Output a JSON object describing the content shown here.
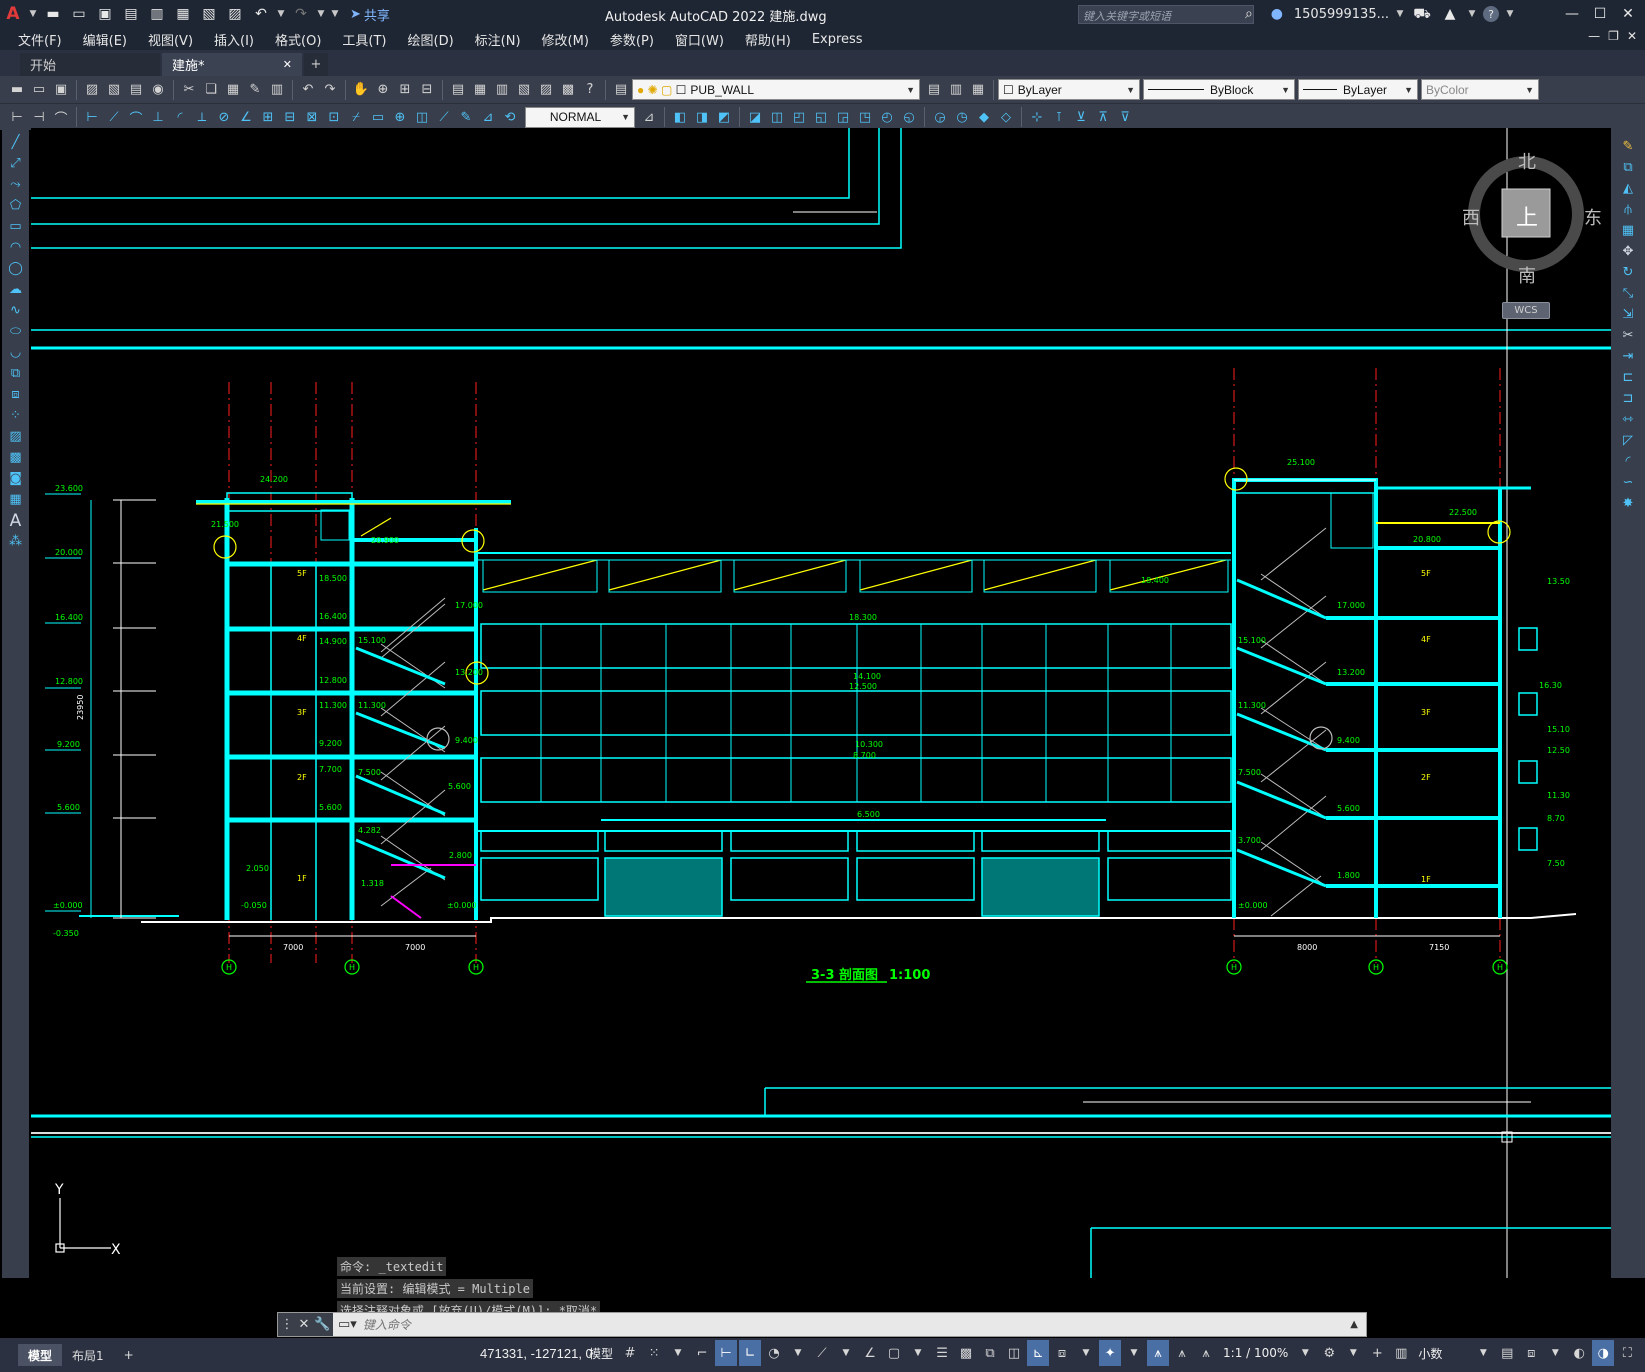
{
  "titlebar": {
    "app_letter": "A",
    "share_label": "共享",
    "title": "Autodesk AutoCAD 2022    建施.dwg",
    "search_placeholder": "键入关键字或短语",
    "user": "1505999135...",
    "help": "?"
  },
  "menu": [
    "文件(F)",
    "编辑(E)",
    "视图(V)",
    "插入(I)",
    "格式(O)",
    "工具(T)",
    "绘图(D)",
    "标注(N)",
    "修改(M)",
    "参数(P)",
    "窗口(W)",
    "帮助(H)",
    "Express"
  ],
  "tabs": {
    "start": "开始",
    "current": "建施*",
    "close": "✕",
    "add": "+"
  },
  "toolbar": {
    "layer": "PUB_WALL",
    "color": "ByLayer",
    "linetype": "ByBlock",
    "lineweight": "ByLayer",
    "plotstyle": "ByColor",
    "dimstyle": "NORMAL"
  },
  "viewcube": {
    "north": "北",
    "south": "南",
    "east": "东",
    "west": "西",
    "top": "上",
    "wcs": "WCS"
  },
  "drawing": {
    "title": "3-3 剖面图",
    "scale": "1:100",
    "elevations_left": [
      "23.600",
      "20.000",
      "16.400",
      "12.800",
      "9.200",
      "5.600",
      "±0.000",
      "-0.350"
    ],
    "overall_height": "23950",
    "spans_left": [
      "7000",
      "7000"
    ],
    "spans_right": [
      "8000",
      "7150"
    ],
    "axis_labels_left": [
      "H",
      "H",
      "H"
    ],
    "axis_labels_right": [
      "H",
      "H",
      "H"
    ],
    "floor_labels": [
      "5F",
      "4F",
      "3F",
      "2F",
      "1F"
    ],
    "roof_levels": [
      "24.200",
      "25.100",
      "21.500",
      "20.900",
      "22.500",
      "20.800"
    ],
    "mid_levels": [
      "18.300",
      "14.100",
      "12.500",
      "10.300",
      "8.700",
      "6.500",
      "18.400"
    ],
    "stair_levels": [
      "17.000",
      "15.100",
      "13.200",
      "11.300",
      "9.400",
      "7.500",
      "5.600",
      "3.700",
      "1.800",
      "±0.000"
    ],
    "floor_levels_left": [
      "18.500",
      "16.400",
      "14.900",
      "12.800",
      "11.300",
      "9.200",
      "7.700",
      "5.600",
      "2.050",
      "-0.050",
      "4.282",
      "2.800",
      "1.318"
    ],
    "right_edge_levels": [
      "13.50",
      "16.30",
      "15.10",
      "12.50",
      "11.30",
      "8.70",
      "7.50"
    ]
  },
  "command": {
    "history": [
      "命令: _textedit",
      "当前设置: 编辑模式 = Multiple",
      "选择注释对象或 [放弃(U)/模式(M)]: *取消*"
    ],
    "placeholder": "键入命令"
  },
  "status": {
    "model_tab": "模型",
    "layout_tab": "布局1",
    "add_tab": "+",
    "coords": "471331, -127121, 0",
    "model_btn": "模型",
    "scale": "1:1 / 100%",
    "units": "小数"
  }
}
